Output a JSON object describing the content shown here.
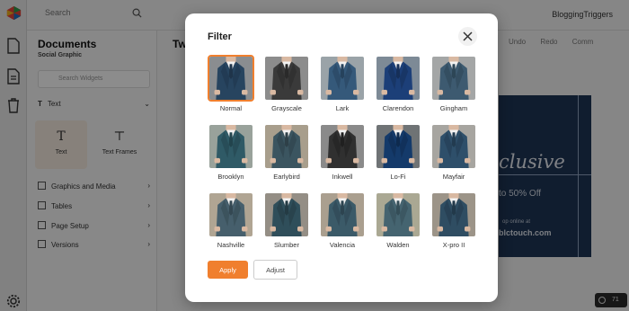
{
  "app": {
    "search_placeholder": "Search",
    "user_name": "BloggingTriggers",
    "panel_title": "Documents",
    "panel_subtitle": "Social Graphic",
    "widget_search_placeholder": "Search Widgets",
    "text_section": "Text",
    "tool_text": "Text",
    "tool_text_frames": "Text Frames",
    "sections": [
      "Graphics and Media",
      "Tables",
      "Page Setup",
      "Versions"
    ],
    "canvas_heading": "Tw",
    "right_tools": [
      "Undo",
      "Redo",
      "Comm"
    ],
    "design_headline": "clusive",
    "design_offer": "to 50% Off",
    "design_small": "op online at",
    "design_site": "blctouch.com",
    "zoom_value": "71"
  },
  "modal": {
    "title": "Filter",
    "apply_label": "Apply",
    "adjust_label": "Adjust",
    "selected": "Normal",
    "filters": [
      {
        "label": "Normal"
      },
      {
        "label": "Grayscale"
      },
      {
        "label": "Lark"
      },
      {
        "label": "Clarendon"
      },
      {
        "label": "Gingham"
      },
      {
        "label": "Brooklyn"
      },
      {
        "label": "Earlybird"
      },
      {
        "label": "Inkwell"
      },
      {
        "label": "Lo-Fi"
      },
      {
        "label": "Mayfair"
      },
      {
        "label": "Nashville"
      },
      {
        "label": "Slumber"
      },
      {
        "label": "Valencia"
      },
      {
        "label": "Walden"
      },
      {
        "label": "X-pro II"
      }
    ]
  },
  "colors": {
    "accent": "#f07f2e",
    "suit_normal": "#27445f",
    "suit_gray": "#3a3a3a",
    "suit_clarendon": "#1c3f78"
  }
}
